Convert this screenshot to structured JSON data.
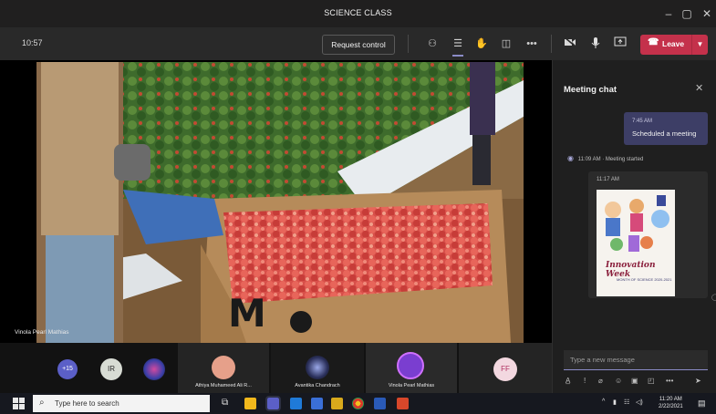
{
  "window": {
    "title": "SCIENCE CLASS"
  },
  "toolbar": {
    "time": "10:57",
    "request_control": "Request control",
    "leave": "Leave"
  },
  "stage": {
    "presenter_name": "Vinola Pearl Mathias"
  },
  "chat": {
    "title": "Meeting chat",
    "my_message": {
      "time": "7:45 AM",
      "text": "Scheduled a meeting"
    },
    "system_event": {
      "time": "11:09 AM",
      "text": "Meeting started"
    },
    "image_message": {
      "time": "11:17 AM",
      "poster_title": "Innovation Week",
      "poster_subtitle": "MONTH OF SCIENCE 2020-2021"
    },
    "compose_placeholder": "Type a new message"
  },
  "participants": [
    {
      "initials": "+15",
      "name": ""
    },
    {
      "initials": "IR",
      "name": ""
    },
    {
      "initials": "",
      "name": ""
    },
    {
      "initials": "",
      "name": "Athiya Muhameed Ali R..."
    },
    {
      "initials": "",
      "name": "Avantika Chandrach"
    },
    {
      "initials": "",
      "name": "Vinola Pearl Mathias"
    },
    {
      "initials": "FF",
      "name": ""
    }
  ],
  "taskbar": {
    "search_placeholder": "Type here to search",
    "time": "11:20 AM",
    "date": "2/22/2021"
  },
  "colors": {
    "leave_red": "#c4314b",
    "accent_purple": "#8b8cc7",
    "bubble_purple": "#3d3e66"
  }
}
